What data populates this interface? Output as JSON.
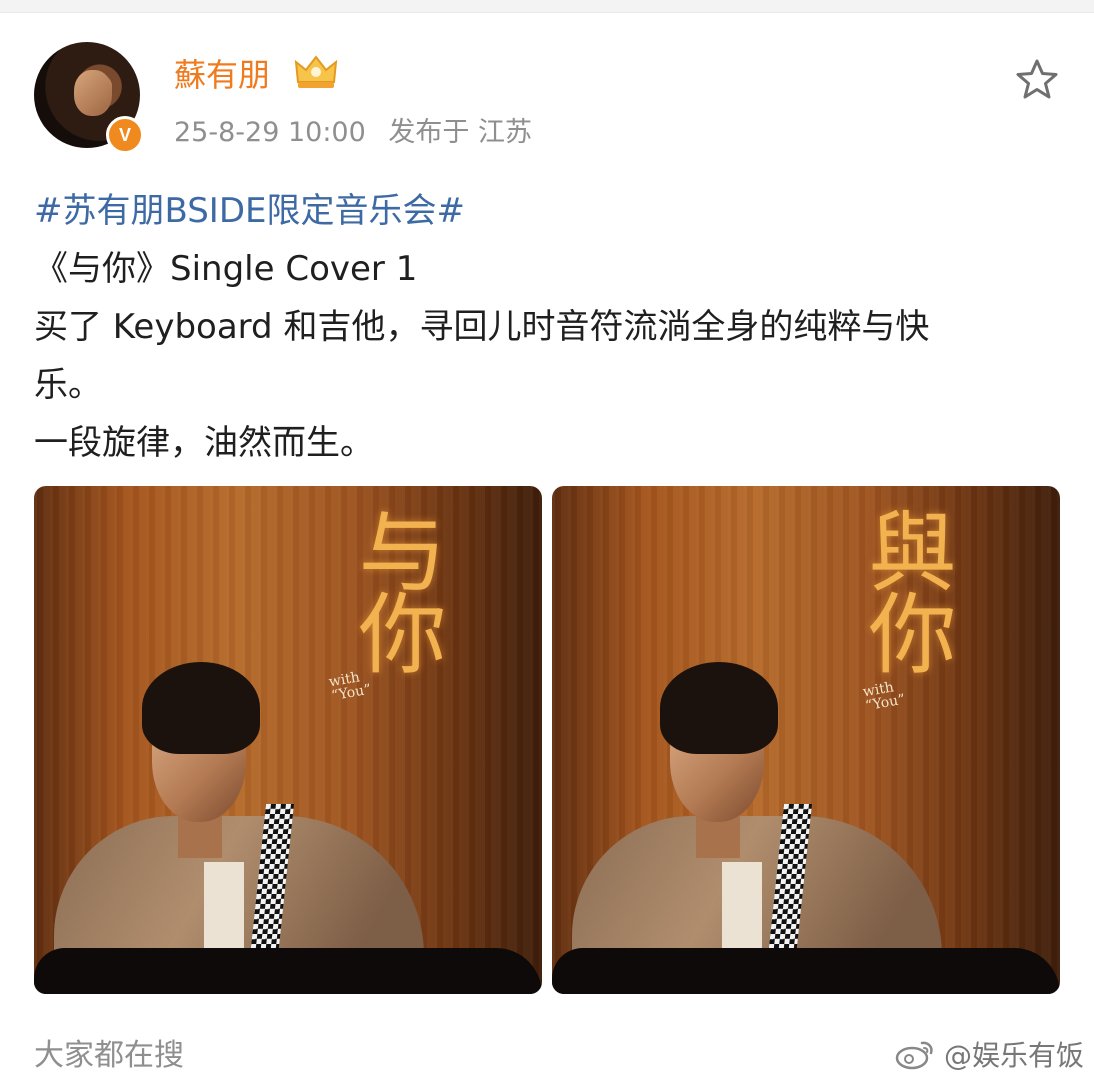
{
  "user": {
    "name": "蘇有朋",
    "verified_badge": "V"
  },
  "meta": {
    "timestamp": "25-8-29 10:00",
    "location": "发布于 江苏"
  },
  "post": {
    "hashtag": "#苏有朋BSIDE限定音乐会#",
    "line1": "《与你》Single Cover 1",
    "line2": "买了 Keyboard 和吉他，寻回儿时音符流淌全身的纯粹与快",
    "line3": "乐。",
    "line4": "一段旋律，油然而生。"
  },
  "photos": [
    {
      "title": "与你",
      "subtitle_with": "with",
      "subtitle_you": "“You”"
    },
    {
      "title": "與你",
      "subtitle_with": "with",
      "subtitle_you": "“You”"
    }
  ],
  "footer": {
    "trending_label": "大家都在搜",
    "watermark": "@娱乐有饭"
  },
  "icons": {
    "avatar_badge": "verified-v-icon",
    "crown": "crown-icon",
    "favorite": "star-icon",
    "weibo": "weibo-logo-icon"
  },
  "colors": {
    "username": "#f07b1e",
    "hashtag": "#3d6aa5",
    "meta": "#8f8f8f",
    "badge": "#f08a1f"
  }
}
